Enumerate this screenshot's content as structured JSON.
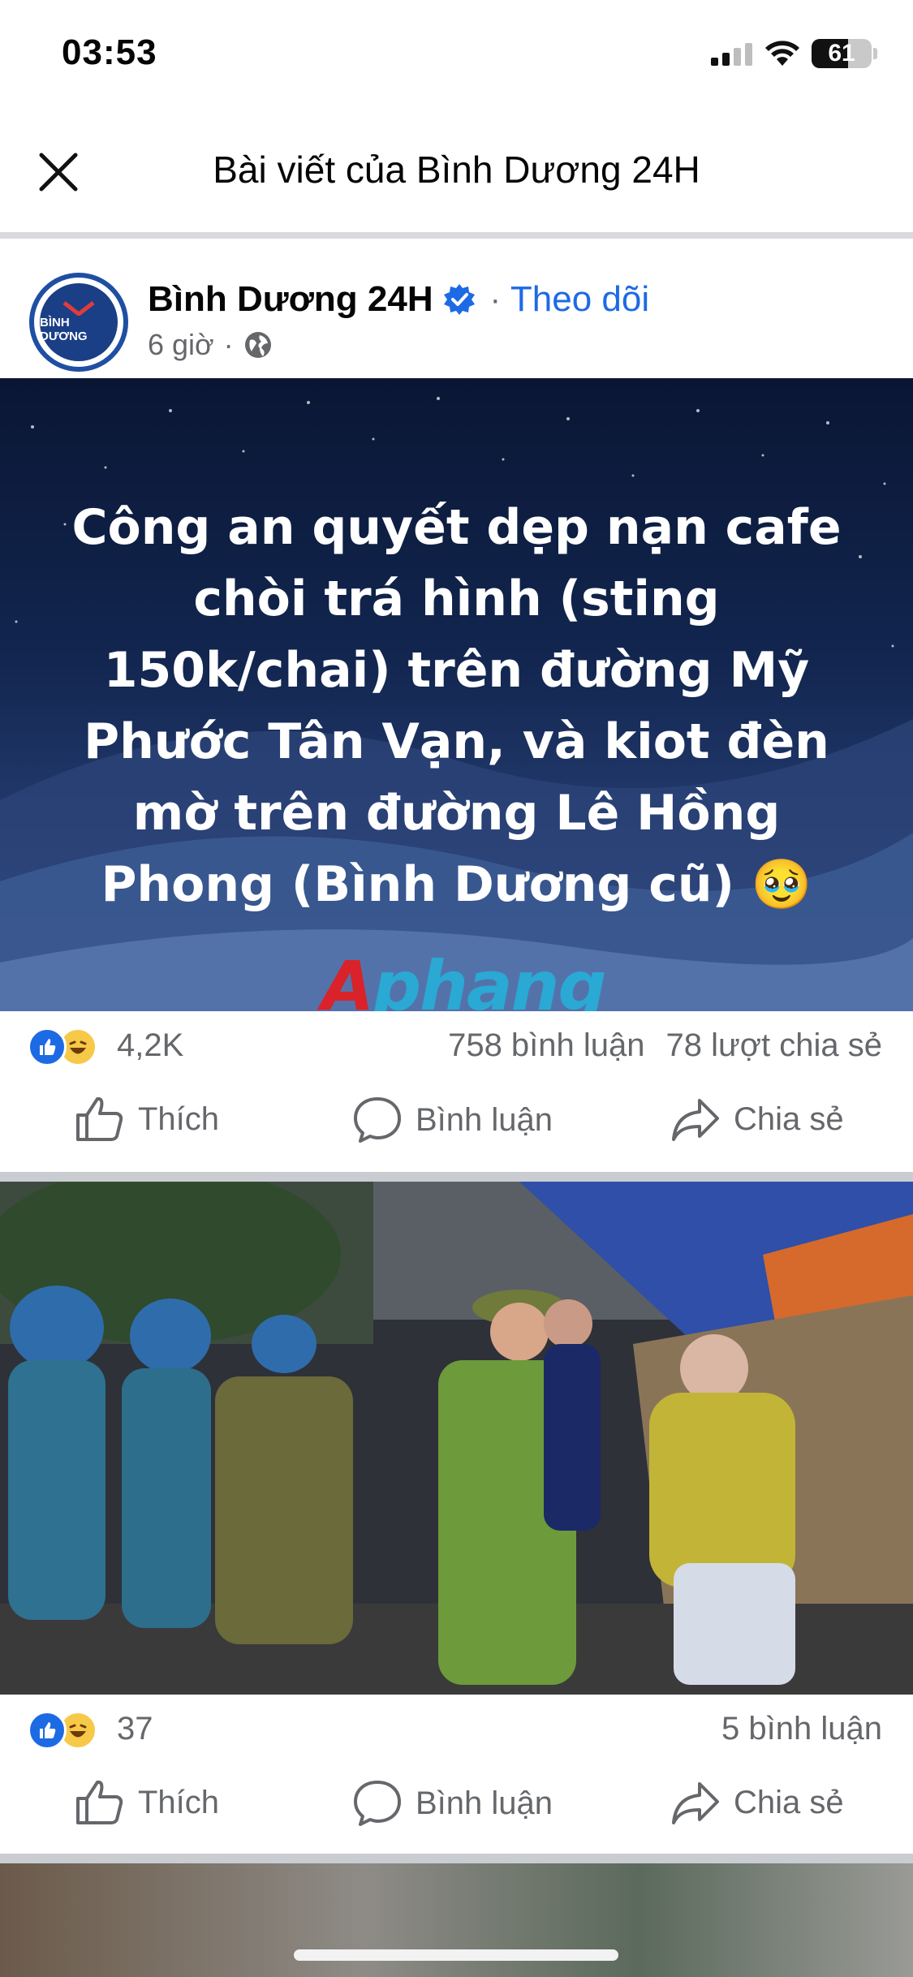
{
  "status_bar": {
    "time": "03:53",
    "battery": "61"
  },
  "nav": {
    "title": "Bài viết của Bình Dương 24H"
  },
  "post": {
    "page_name": "Bình Dương 24H",
    "follow": "Theo dõi",
    "time_ago": "6 giờ",
    "separator": "·",
    "avatar_text": "BÌNH DƯƠNG",
    "hero_text": "Công an quyết dẹp nạn cafe chòi trá hình (sting 150k/chai) trên đường Mỹ Phước Tân Vạn, và kiot đèn mờ trên đường Lê Hồng Phong (Bình Dương cũ) 🥹",
    "watermark_a": "A",
    "watermark_rest": "phang",
    "reactions_count": "4,2K",
    "comments": "758 bình luận",
    "shares": "78 lượt chia sẻ"
  },
  "photo_post": {
    "reactions_count": "37",
    "comments": "5 bình luận"
  },
  "actions": {
    "like": "Thích",
    "comment": "Bình luận",
    "share": "Chia sẻ"
  },
  "colors": {
    "accent": "#1d6ae5",
    "divider": "#c9ccd1",
    "muted_text": "#65676b"
  }
}
